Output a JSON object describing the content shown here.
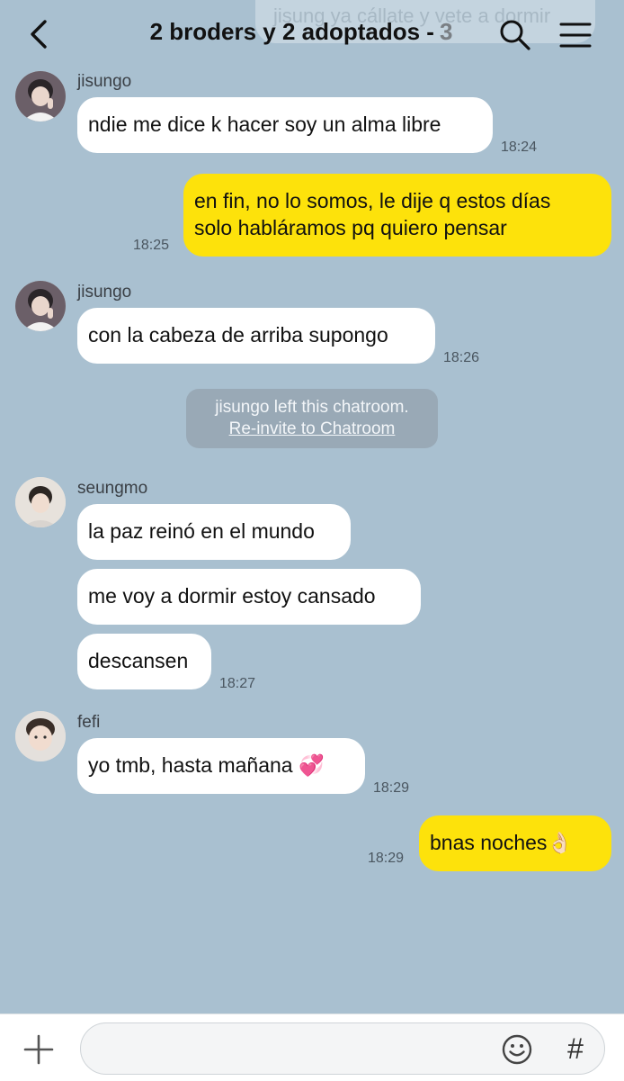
{
  "header": {
    "ghost_text": "jisung ya cállate y vete a dormir",
    "title": "2 broders y 2 adoptados -",
    "member_count": "3",
    "back_icon": "chevron-left-icon",
    "search_icon": "search-icon",
    "menu_icon": "hamburger-menu-icon"
  },
  "messages": {
    "m1": {
      "sender": "jisungo",
      "text": "ndie me dice k hacer soy un alma libre",
      "time": "18:24"
    },
    "m2": {
      "text": "en fin, no lo somos, le dije q estos días\nsolo habláramos pq quiero pensar",
      "time": "18:25"
    },
    "m3": {
      "sender": "jisungo",
      "text": "con la cabeza de arriba supongo",
      "time": "18:26"
    },
    "system": {
      "text": "jisungo left this chatroom.",
      "link": "Re-invite to Chatroom"
    },
    "m4": {
      "sender": "seungmo",
      "text1": "la paz reinó en el mundo",
      "text2": "me voy a dormir estoy cansado",
      "text3": "descansen",
      "time": "18:27"
    },
    "m5": {
      "sender": "fefi",
      "text": "yo tmb, hasta mañana 💞",
      "time": "18:29"
    },
    "m6": {
      "text": "bnas noches👌🏻",
      "time": "18:29"
    }
  },
  "input_bar": {
    "plus_icon": "plus-icon",
    "placeholder": "",
    "emoji_icon": "emoji-icon",
    "hash_label": "#"
  },
  "colors": {
    "background": "#a9c0d0",
    "my_bubble": "#fde20b",
    "other_bubble": "#ffffff"
  }
}
